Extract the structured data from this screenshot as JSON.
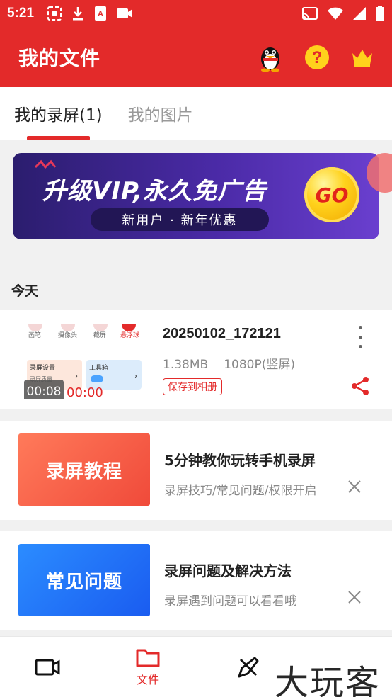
{
  "status_bar": {
    "time": "5:21"
  },
  "app_bar": {
    "title": "我的文件"
  },
  "tabs": [
    {
      "label": "我的录屏(1)",
      "active": true
    },
    {
      "label": "我的图片",
      "active": false
    }
  ],
  "banner": {
    "title": "升级VIP,永久免广告",
    "subtitle": "新用户 · 新年优惠",
    "go_label": "GO"
  },
  "section": {
    "label": "今天"
  },
  "recording": {
    "filename": "20250102_172121",
    "size": "1.38MB",
    "resolution": "1080P(竖屏)",
    "save_label": "保存到相册",
    "duration": "00:08",
    "time_overlay": "00:00",
    "thumb_labels": [
      "画笔",
      "摄像头",
      "截屏",
      "悬浮球"
    ],
    "thumb_box_labels": [
      "录屏设置",
      "工具箱"
    ],
    "thumb_box_sub": "录屏质量"
  },
  "tips": [
    {
      "image_text": "录屏教程",
      "title": "5分钟教你玩转手机录屏",
      "subtitle": "录屏技巧/常见问题/权限开启"
    },
    {
      "image_text": "常见问题",
      "title": "录屏问题及解决方法",
      "subtitle": "录屏遇到问题可以看看哦"
    }
  ],
  "bottom_nav": {
    "files_label": "文件"
  },
  "watermark": "大玩客",
  "colors": {
    "accent": "#e32a2a",
    "banner": "#4a2aa6"
  }
}
